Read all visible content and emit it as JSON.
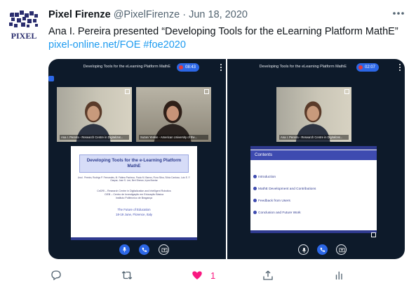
{
  "author": {
    "name": "Pixel Firenze",
    "handle": "@PixelFirenze",
    "separator": "·",
    "date": "Jun 18, 2020",
    "logo_text": "PIXEL"
  },
  "tweet": {
    "text": "Ana I. Pereira presented “Developing Tools for the eLearning Platform MathE”",
    "link": "pixel-online.net/FOE",
    "hashtag": "#foe2020"
  },
  "left_panel": {
    "title": "Developing Tools for the eLearning Platform MathE",
    "timer": "08:43",
    "video_1_caption": "Ana I. Pereira - Research Centre in Digitalizat...",
    "video_2_caption": "Suzan Yenkin - American University of the...",
    "slide": {
      "title": "Developing Tools for the e-Learning Platform MathE",
      "authors": "Ana I. Pereira, Rodrigo P. Fernandes, M. Fátima Pacheco, Paulo M. Barros, Flora Silva, Sílvia Cardoso, Luís E. F. Gaspar, Jose S. Lee, Beri Sheran, Iryna Bondar",
      "affiliations": [
        "CeDRI – Research Centre in Digitalization and Intelligent Robotics",
        "CIEB – Centro de Investigação em Educação Básica",
        "Instituto Politécnico de Bragança"
      ],
      "event": "The Future of Education",
      "event_details": "18-19 June, Florence, Italy"
    }
  },
  "right_panel": {
    "title": "Developing Tools for the eLearning Platform MathE",
    "timer": "02:07",
    "video_caption": "Ana I. Pereira - Research Centre in Digitalizat...",
    "slide": {
      "heading": "Contents",
      "items": [
        "Introduction",
        "MathE Development and Contributions",
        "Feedback from Users",
        "Conclusion and Future Work"
      ]
    }
  },
  "actions": {
    "like_count": "1"
  },
  "colors": {
    "link": "#1d9bf0",
    "like": "#f91880",
    "conference_bg": "#0d1a2a",
    "accent_blue": "#2c67e6"
  },
  "icons": [
    "more-icon",
    "reply-icon",
    "retweet-icon",
    "heart-icon",
    "share-icon",
    "analytics-icon",
    "mic-icon",
    "phone-icon",
    "screen-share-icon"
  ]
}
